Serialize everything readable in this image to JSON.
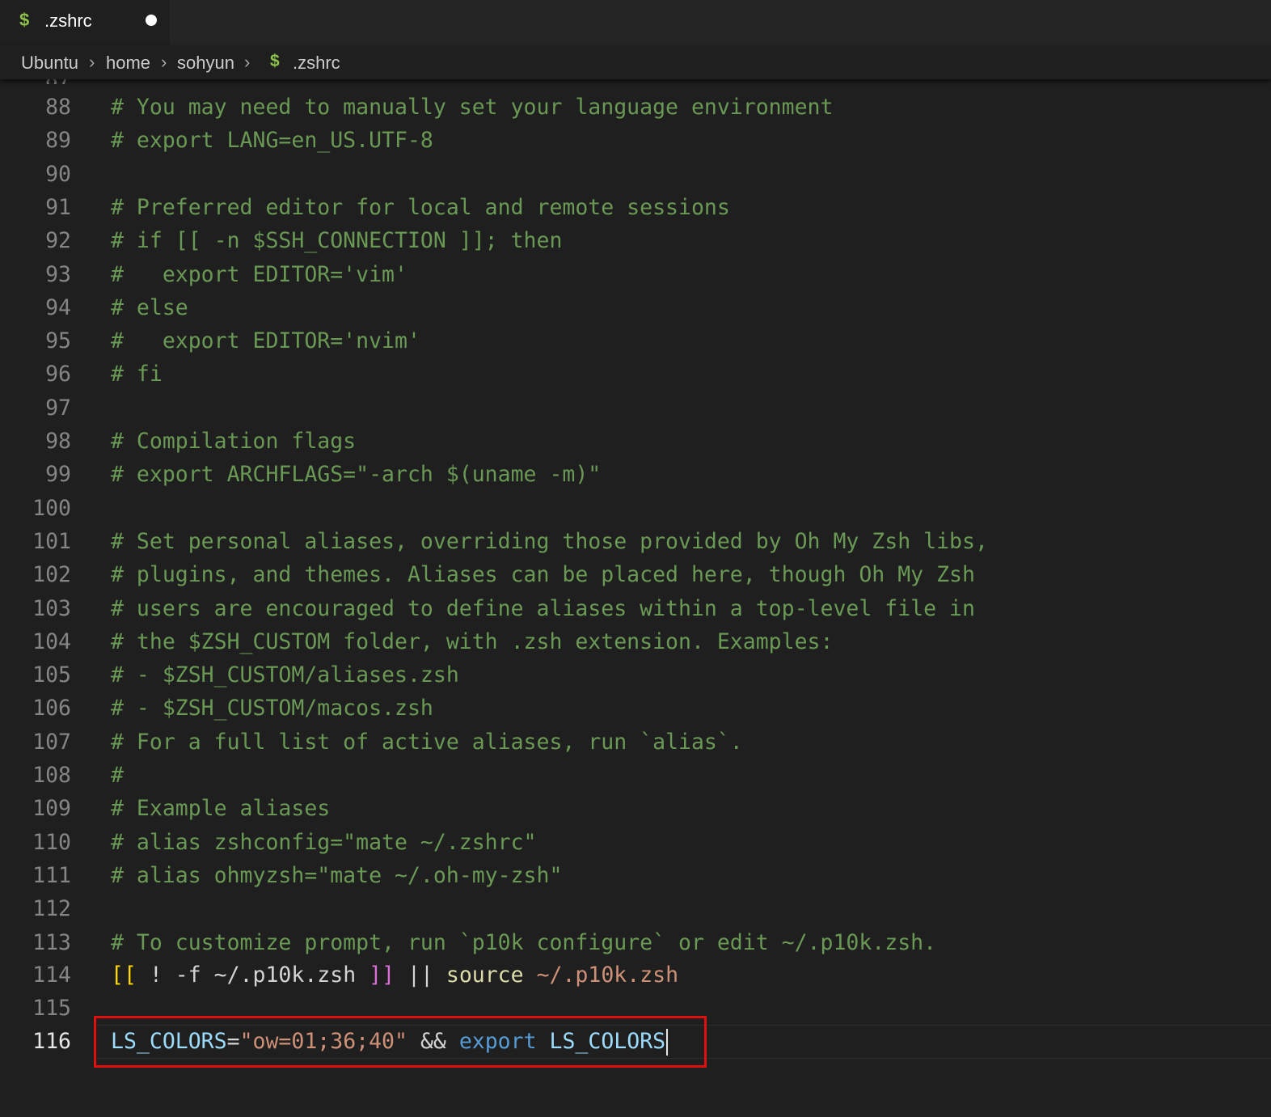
{
  "tab": {
    "icon": "$",
    "icon_name": "shell-dollar-icon",
    "label": ".zshrc",
    "dirty": true
  },
  "breadcrumb": {
    "items": [
      "Ubuntu",
      "home",
      "sohyun"
    ],
    "file_icon": "$",
    "file": ".zshrc"
  },
  "colors": {
    "comment": "#6a9955",
    "bracket1": "#ffd700",
    "bracket2": "#da70d6",
    "string": "#ce9178",
    "variable": "#9cdcfe",
    "keyword": "#569cd6",
    "highlight_box": "#e01010",
    "shell_icon": "#8dc149"
  },
  "editor": {
    "active_line": 116,
    "lines": [
      {
        "n": "88",
        "text": "# You may need to manually set your language environment"
      },
      {
        "n": "89",
        "text": "# export LANG=en_US.UTF-8"
      },
      {
        "n": "90",
        "text": ""
      },
      {
        "n": "91",
        "text": "# Preferred editor for local and remote sessions"
      },
      {
        "n": "92",
        "text": "# if [[ -n $SSH_CONNECTION ]]; then"
      },
      {
        "n": "93",
        "text": "#   export EDITOR='vim'"
      },
      {
        "n": "94",
        "text": "# else"
      },
      {
        "n": "95",
        "text": "#   export EDITOR='nvim'"
      },
      {
        "n": "96",
        "text": "# fi"
      },
      {
        "n": "97",
        "text": ""
      },
      {
        "n": "98",
        "text": "# Compilation flags"
      },
      {
        "n": "99",
        "text": "# export ARCHFLAGS=\"-arch $(uname -m)\""
      },
      {
        "n": "100",
        "text": ""
      },
      {
        "n": "101",
        "text": "# Set personal aliases, overriding those provided by Oh My Zsh libs,"
      },
      {
        "n": "102",
        "text": "# plugins, and themes. Aliases can be placed here, though Oh My Zsh"
      },
      {
        "n": "103",
        "text": "# users are encouraged to define aliases within a top-level file in"
      },
      {
        "n": "104",
        "text": "# the $ZSH_CUSTOM folder, with .zsh extension. Examples:"
      },
      {
        "n": "105",
        "text": "# - $ZSH_CUSTOM/aliases.zsh"
      },
      {
        "n": "106",
        "text": "# - $ZSH_CUSTOM/macos.zsh"
      },
      {
        "n": "107",
        "text": "# For a full list of active aliases, run `alias`."
      },
      {
        "n": "108",
        "text": "#"
      },
      {
        "n": "109",
        "text": "# Example aliases"
      },
      {
        "n": "110",
        "text": "# alias zshconfig=\"mate ~/.zshrc\""
      },
      {
        "n": "111",
        "text": "# alias ohmyzsh=\"mate ~/.oh-my-zsh\""
      },
      {
        "n": "112",
        "text": ""
      },
      {
        "n": "113",
        "text": "# To customize prompt, run `p10k configure` or edit ~/.p10k.zsh."
      }
    ],
    "line114": {
      "n": "114",
      "open_bracket": "[[",
      "flag": " ! -f ~/.p10k.zsh ",
      "close_bracket": "]]",
      "or_op": " || ",
      "cmd": "source",
      "space": " ",
      "path": "~/.p10k.zsh"
    },
    "line115": {
      "n": "115"
    },
    "line116": {
      "n": "116",
      "var": "LS_COLORS",
      "eq": "=",
      "value": "\"ow=01;36;40\"",
      "and_op": " && ",
      "kw": "export",
      "space": " ",
      "var2": "LS_COLORS"
    }
  }
}
